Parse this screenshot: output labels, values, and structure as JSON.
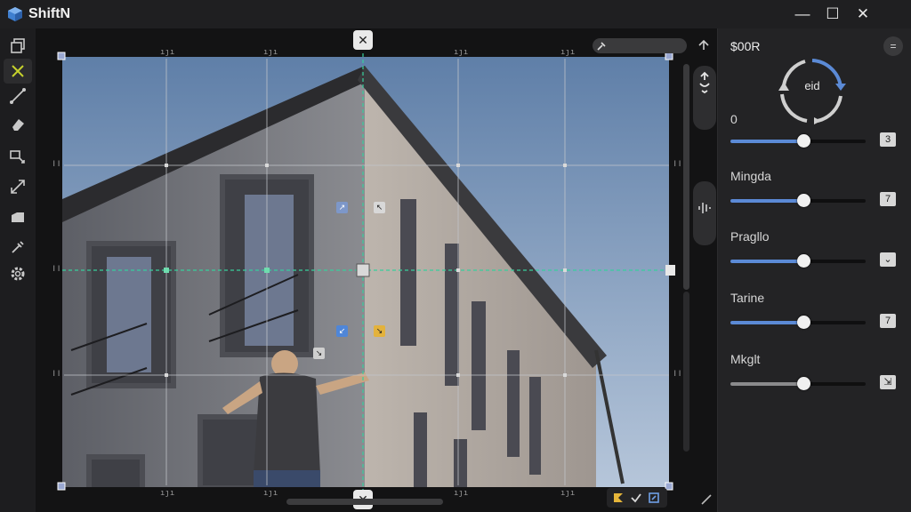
{
  "app": {
    "title": "ShiftN"
  },
  "window_controls": {
    "minimize": "—",
    "maximize": "☐",
    "close": "✕"
  },
  "toolbar": {
    "tools": [
      {
        "name": "layers-icon"
      },
      {
        "name": "crop-x-icon"
      },
      {
        "name": "line-tool-icon"
      },
      {
        "name": "eraser-icon"
      },
      {
        "name": "transform-icon"
      },
      {
        "name": "expand-arrows-icon"
      },
      {
        "name": "fill-icon"
      },
      {
        "name": "eyedropper-icon"
      },
      {
        "name": "settings-gear-icon"
      }
    ],
    "active_color": "#c6d22c"
  },
  "canvas": {
    "guide_button_glyph": "✕",
    "guide_color": "#34c79a",
    "grid_color": "#bfc3c8"
  },
  "panel": {
    "title": "$00R",
    "menu_glyph": "=",
    "rotate_label": "eid",
    "accent": "#4f7fc8",
    "sliders": [
      {
        "label": "0",
        "value": 0.54,
        "box": "3"
      },
      {
        "label": "Mingda",
        "value": 0.54,
        "box": "7"
      },
      {
        "label": "Pragllo",
        "value": 0.54,
        "box": "⌄"
      },
      {
        "label": "Tarine",
        "value": 0.54,
        "box": "7"
      },
      {
        "label": "Mkglt",
        "value": 0.54,
        "box": "⇲"
      }
    ]
  }
}
